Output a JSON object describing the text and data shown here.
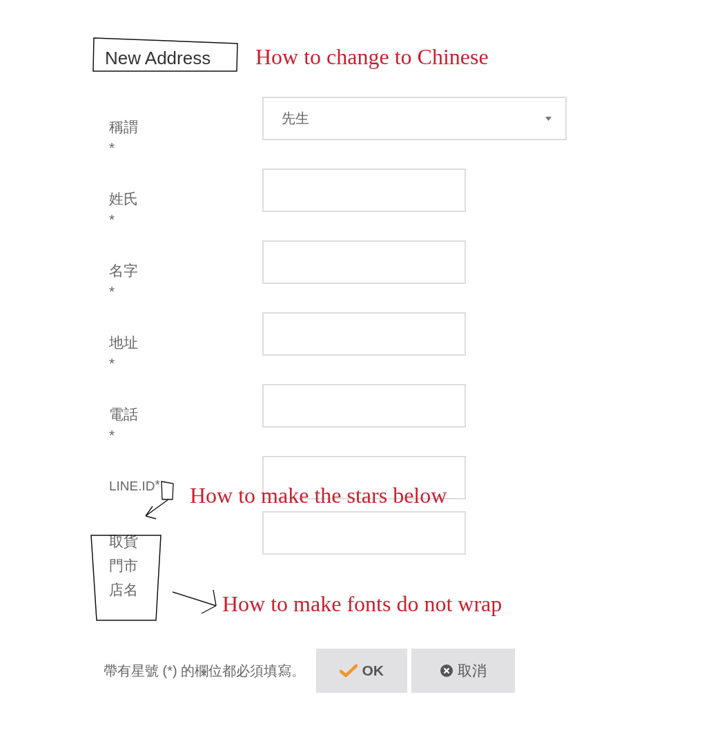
{
  "title": "New Address",
  "fields": [
    {
      "label": "稱謂",
      "mark": "*",
      "mark_inline": false,
      "kind": "select",
      "value": "先生"
    },
    {
      "label": "姓氏",
      "mark": "*",
      "mark_inline": false,
      "kind": "text"
    },
    {
      "label": "名字",
      "mark": "*",
      "mark_inline": false,
      "kind": "text"
    },
    {
      "label": "地址",
      "mark": "*",
      "mark_inline": false,
      "kind": "text"
    },
    {
      "label": "電話",
      "mark": "*",
      "mark_inline": false,
      "kind": "text"
    },
    {
      "label": "LINE.ID",
      "mark": "*",
      "mark_inline": true,
      "kind": "text"
    },
    {
      "label": "取貨門市店名",
      "kind": "text"
    }
  ],
  "footer": {
    "note": "帶有星號 (*) 的欄位都必須填寫。",
    "buttons": [
      {
        "label": "OK",
        "kind": "ok"
      },
      {
        "label": "取消",
        "kind": "cancel"
      }
    ]
  },
  "annotations": [
    {
      "text": "How to change to Chinese"
    },
    {
      "text": "How to make the stars below"
    },
    {
      "text": "How to make fonts do not wrap"
    }
  ]
}
